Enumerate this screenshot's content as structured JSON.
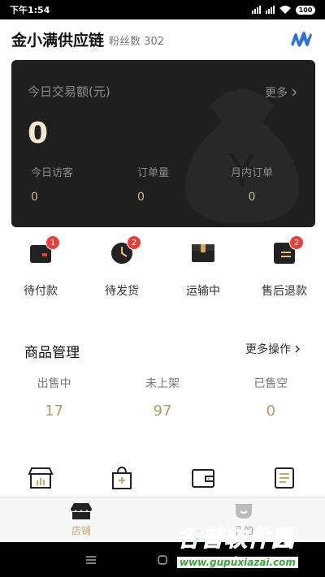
{
  "status_bar": {
    "time": "下午1:54",
    "battery": "100"
  },
  "header": {
    "shop_name": "金小满供应链",
    "fans_label": "粉丝数",
    "fans_count": "302"
  },
  "card": {
    "title": "今日交易额(元)",
    "more": "更多",
    "amount": "0",
    "stats": [
      {
        "label": "今日访客",
        "value": "0"
      },
      {
        "label": "订单量",
        "value": "0"
      },
      {
        "label": "月内订单",
        "value": "0"
      }
    ]
  },
  "orders": [
    {
      "label": "待付款",
      "badge": "1",
      "icon": "wallet-icon"
    },
    {
      "label": "待发货",
      "badge": "2",
      "icon": "clock-icon"
    },
    {
      "label": "运输中",
      "badge": "",
      "icon": "box-icon"
    },
    {
      "label": "售后退款",
      "badge": "2",
      "icon": "refund-icon"
    }
  ],
  "product_management": {
    "title": "商品管理",
    "more": "更多操作",
    "stats": [
      {
        "label": "出售中",
        "value": "17"
      },
      {
        "label": "未上架",
        "value": "97"
      },
      {
        "label": "已售空",
        "value": "0"
      }
    ]
  },
  "tools": [
    "store-chart-icon",
    "shopping-bag-plus-icon",
    "wallet-outline-icon",
    "document-list-icon"
  ],
  "tabbar": {
    "tabs": [
      {
        "label": "店铺",
        "active": true,
        "icon": "store-icon"
      },
      {
        "label": "我的",
        "active": false,
        "icon": "profile-icon"
      }
    ]
  },
  "watermark": {
    "text": "谷普软件园",
    "url": "www.gupuxiazai.com"
  },
  "colors": {
    "accent": "#c9a76e",
    "card_bg": "#1f1f1f",
    "badge": "#e5403b",
    "value_gold": "#b39a6b"
  }
}
